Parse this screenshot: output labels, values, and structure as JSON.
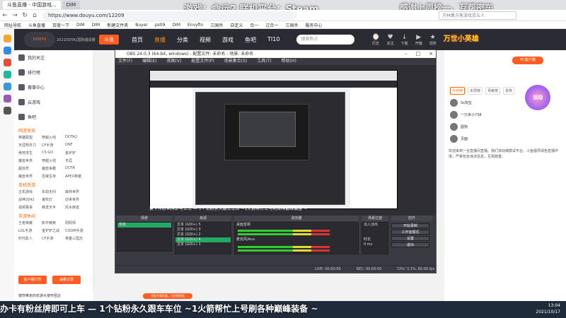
{
  "browser": {
    "tabs": [
      "斗鱼直播 - 中国游戏...",
      "DIM"
    ],
    "url": "https://www.douyu.com/12209",
    "search_placeholder": "万林集万客游戏货五人",
    "bookmarks": [
      "网址导航",
      "斗鱼直播",
      "百度一下",
      "DIM",
      "DIM",
      "新建文件夹",
      "Buyer",
      "ps09",
      "DIM",
      "Envyfin",
      "三国杀",
      "自定义",
      "合一",
      "过合一",
      "三国杀",
      "服务中心"
    ]
  },
  "overlay": {
    "game_title": "游戏：命运2 联机平台：Steam",
    "right_title": "感谢上周榜一、互帮密车"
  },
  "douyu": {
    "logo": "DOUYU",
    "logo_sub": "2021DOTA2国际邀请赛",
    "badge": "斗鱼",
    "nav": [
      "首页",
      "直播",
      "分类",
      "视频",
      "游戏",
      "鱼吧",
      "TI10"
    ],
    "search_placeholder": "搜索焦点",
    "header_icons": [
      "历史",
      "关注",
      "下载",
      "开播",
      "领奖"
    ],
    "banner": "万世小英雄",
    "sidebar_top": [
      "我的关注",
      "排行榜",
      "赛事中心",
      "云游戏",
      "鱼吧"
    ],
    "sidebar_sec1": "网游竞技",
    "sidebar_grid1": [
      "英雄联盟",
      "穿越火线",
      "DOTA2",
      "天涯明月刀",
      "CF手游",
      "DNF",
      "绝地求生",
      "CS:GO",
      "金铲铲",
      "魔兽世界",
      "穿越火线",
      "天涯",
      "超自然",
      "魔兽争霸",
      "DOTA",
      "魔兽世界",
      "否接生存",
      "APEX英雄"
    ],
    "sidebar_sec2": "单机热游",
    "sidebar_grid2": [
      "主机游戏",
      "永劫无间",
      "森林世界",
      "战神2042",
      "鬼吹灯",
      "创世世界",
      "视频赛事",
      "峰发天平",
      "风木族迹"
    ],
    "sidebar_sec3": "手游休闲",
    "sidebar_grid3": [
      "王者荣耀",
      "和平精英",
      "阴阳师",
      "LOL手游",
      "金铲铲之战",
      "CODM手游",
      "时代影人",
      "CF手游",
      "英雄三国志"
    ],
    "side_buttons": [
      "客户端打开",
      "海量记录"
    ],
    "ad_text": "按你带走的农游大使开团达",
    "pc_btn": "PC客户端",
    "right_tabs": [
      "今日榜",
      "本周榜",
      "贡献榜",
      "贵族"
    ],
    "right_users": [
      "Ss淘宝",
      "一只米小738",
      "圆狗",
      "页面"
    ],
    "notice": "欢迎来到一台直播间直播。我们该动偶鼓试平台。斗鱼倡导绿色直播环境，严禁包含违法信息。互相尊重。",
    "circle_badge": "活动",
    "chat_pill": "领取专属优惠，可优购密贴"
  },
  "obs": {
    "title": "OBS 24.0.3 (64-bit, windows) - 配置文件: 未命名 - 场景: 未命名",
    "menu": [
      "文件(F)",
      "编辑(E)",
      "视图(V)",
      "配置文件(P)",
      "场景集合(S)",
      "工具(T)",
      "帮助(H)"
    ],
    "ticker": "套卡有粉丝牌即可上车 — 1个钻粉永久跟车车位 ~1火箭帮忙上号刷各种巅峰装备 ~",
    "docks": {
      "scenes": "场景",
      "sources": "来源",
      "mixer": "混音器",
      "transitions": "场景过渡",
      "controls": "控件"
    },
    "scene_item": "场景",
    "sources": [
      "文本 (GDI+) 5",
      "文本 (GDI+) 3",
      "文本 (GDI+) 2",
      "文本 (GDI+) 4",
      "文本 (GDI+) 1"
    ],
    "mixer": [
      "桌面音频",
      "麦克风/Aux"
    ],
    "transition": "淡入淡出",
    "duration_label": "时长",
    "duration": "0 ms",
    "controls": [
      "开始录制",
      "工作室模式",
      "设置",
      "退出"
    ],
    "status": [
      "LIVE: 00:00:00",
      "REC: 00:00:00",
      "CPU: 3.1%, 60.00 fps"
    ]
  },
  "taskbar": {
    "marquee": "办卡有粉丝牌即可上车 — 1个钻粉永久跟车车位 ~1火箭帮忙上号刷各种巅峰装备 ~",
    "time": "13:04",
    "date": "2021/10/17"
  }
}
